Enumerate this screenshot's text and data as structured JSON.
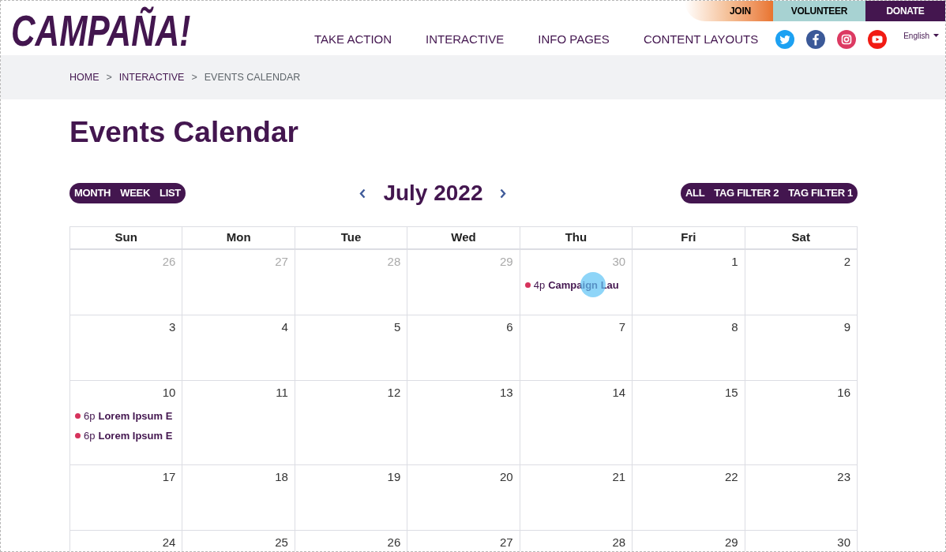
{
  "utility_links": [
    {
      "label": "JOIN",
      "kind": "join"
    },
    {
      "label": "VOLUNTEER",
      "kind": "volunteer"
    },
    {
      "label": "DONATE",
      "kind": "donate"
    }
  ],
  "logo": "CAMPAÑA!",
  "nav": [
    "TAKE ACTION",
    "INTERACTIVE",
    "INFO PAGES",
    "CONTENT LAYOUTS"
  ],
  "language": "English",
  "breadcrumb": [
    {
      "kind": "link",
      "label": "HOME"
    },
    {
      "kind": "separator",
      "label": ">"
    },
    {
      "kind": "link",
      "label": "INTERACTIVE"
    },
    {
      "kind": "separator",
      "label": ">"
    },
    {
      "kind": "current",
      "label": "EVENTS CALENDAR"
    }
  ],
  "page_title": "Events Calendar",
  "view_buttons": [
    "MONTH",
    "WEEK",
    "LIST"
  ],
  "month_title": "July 2022",
  "tag_filters": [
    "ALL",
    "TAG FILTER 2",
    "TAG FILTER 1"
  ],
  "calendar": {
    "weekdays": [
      "Sun",
      "Mon",
      "Tue",
      "Wed",
      "Thu",
      "Fri",
      "Sat"
    ],
    "weeks": [
      [
        {
          "day": "26",
          "other_month": true
        },
        {
          "day": "27",
          "other_month": true
        },
        {
          "day": "28",
          "other_month": true
        },
        {
          "day": "29",
          "other_month": true
        },
        {
          "day": "30",
          "other_month": true,
          "events": [
            {
              "time": "4p",
              "title": "Campaign Lau"
            }
          ]
        },
        {
          "day": "1",
          "other_month": false
        },
        {
          "day": "2",
          "other_month": false
        }
      ],
      [
        {
          "day": "3",
          "other_month": false
        },
        {
          "day": "4",
          "other_month": false
        },
        {
          "day": "5",
          "other_month": false
        },
        {
          "day": "6",
          "other_month": false
        },
        {
          "day": "7",
          "other_month": false
        },
        {
          "day": "8",
          "other_month": false
        },
        {
          "day": "9",
          "other_month": false
        }
      ],
      [
        {
          "day": "10",
          "other_month": false,
          "events": [
            {
              "time": "6p",
              "title": "Lorem Ipsum E"
            },
            {
              "time": "6p",
              "title": "Lorem Ipsum E"
            }
          ]
        },
        {
          "day": "11",
          "other_month": false
        },
        {
          "day": "12",
          "other_month": false
        },
        {
          "day": "13",
          "other_month": false
        },
        {
          "day": "14",
          "other_month": false
        },
        {
          "day": "15",
          "other_month": false
        },
        {
          "day": "16",
          "other_month": false
        }
      ],
      [
        {
          "day": "17",
          "other_month": false
        },
        {
          "day": "18",
          "other_month": false
        },
        {
          "day": "19",
          "other_month": false
        },
        {
          "day": "20",
          "other_month": false
        },
        {
          "day": "21",
          "other_month": false
        },
        {
          "day": "22",
          "other_month": false
        },
        {
          "day": "23",
          "other_month": false
        }
      ],
      [
        {
          "day": "24",
          "other_month": false
        },
        {
          "day": "25",
          "other_month": false
        },
        {
          "day": "26",
          "other_month": false
        },
        {
          "day": "27",
          "other_month": false
        },
        {
          "day": "28",
          "other_month": false
        },
        {
          "day": "29",
          "other_month": false
        },
        {
          "day": "30",
          "other_month": false
        }
      ]
    ]
  }
}
